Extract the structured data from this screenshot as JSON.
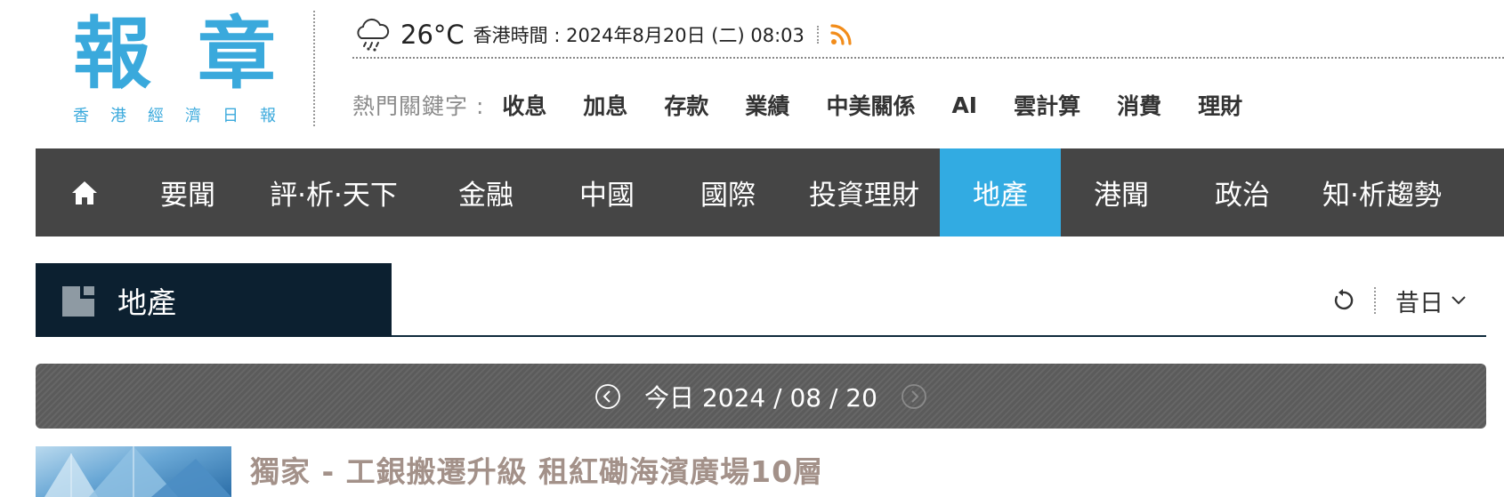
{
  "logo": {
    "main": [
      "報",
      "章"
    ],
    "sub": [
      "香",
      "港",
      "經",
      "濟",
      "日",
      "報"
    ]
  },
  "topbar": {
    "temperature": "26°C",
    "time_text": "香港時間 : 2024年8月20日 (二) 08:03",
    "weather_icon": "cloud-rain-icon",
    "rss_icon": "rss-icon"
  },
  "keywords": {
    "label": "熱門關鍵字 :",
    "items": [
      "收息",
      "加息",
      "存款",
      "業績",
      "中美關係",
      "AI",
      "雲計算",
      "消費",
      "理財"
    ]
  },
  "nav": {
    "home_icon": "home-icon",
    "items": [
      {
        "label": "要聞",
        "active": false
      },
      {
        "label": "評·析·天下",
        "active": false
      },
      {
        "label": "金融",
        "active": false
      },
      {
        "label": "中國",
        "active": false
      },
      {
        "label": "國際",
        "active": false
      },
      {
        "label": "投資理財",
        "active": false
      },
      {
        "label": "地產",
        "active": true
      },
      {
        "label": "港聞",
        "active": false
      },
      {
        "label": "政治",
        "active": false
      },
      {
        "label": "知·析趨勢",
        "active": false
      }
    ],
    "active_color": "#32abe2",
    "bg_color": "#454545"
  },
  "section": {
    "title": "地產",
    "day_select": "昔日",
    "refresh_icon": "refresh-icon"
  },
  "date_bar": {
    "text": "今日 2024 / 08 / 20"
  },
  "article": {
    "title": "獨家 - 工銀搬遷升級 租紅磡海濱廣場10層",
    "title_color": "#a39189"
  }
}
